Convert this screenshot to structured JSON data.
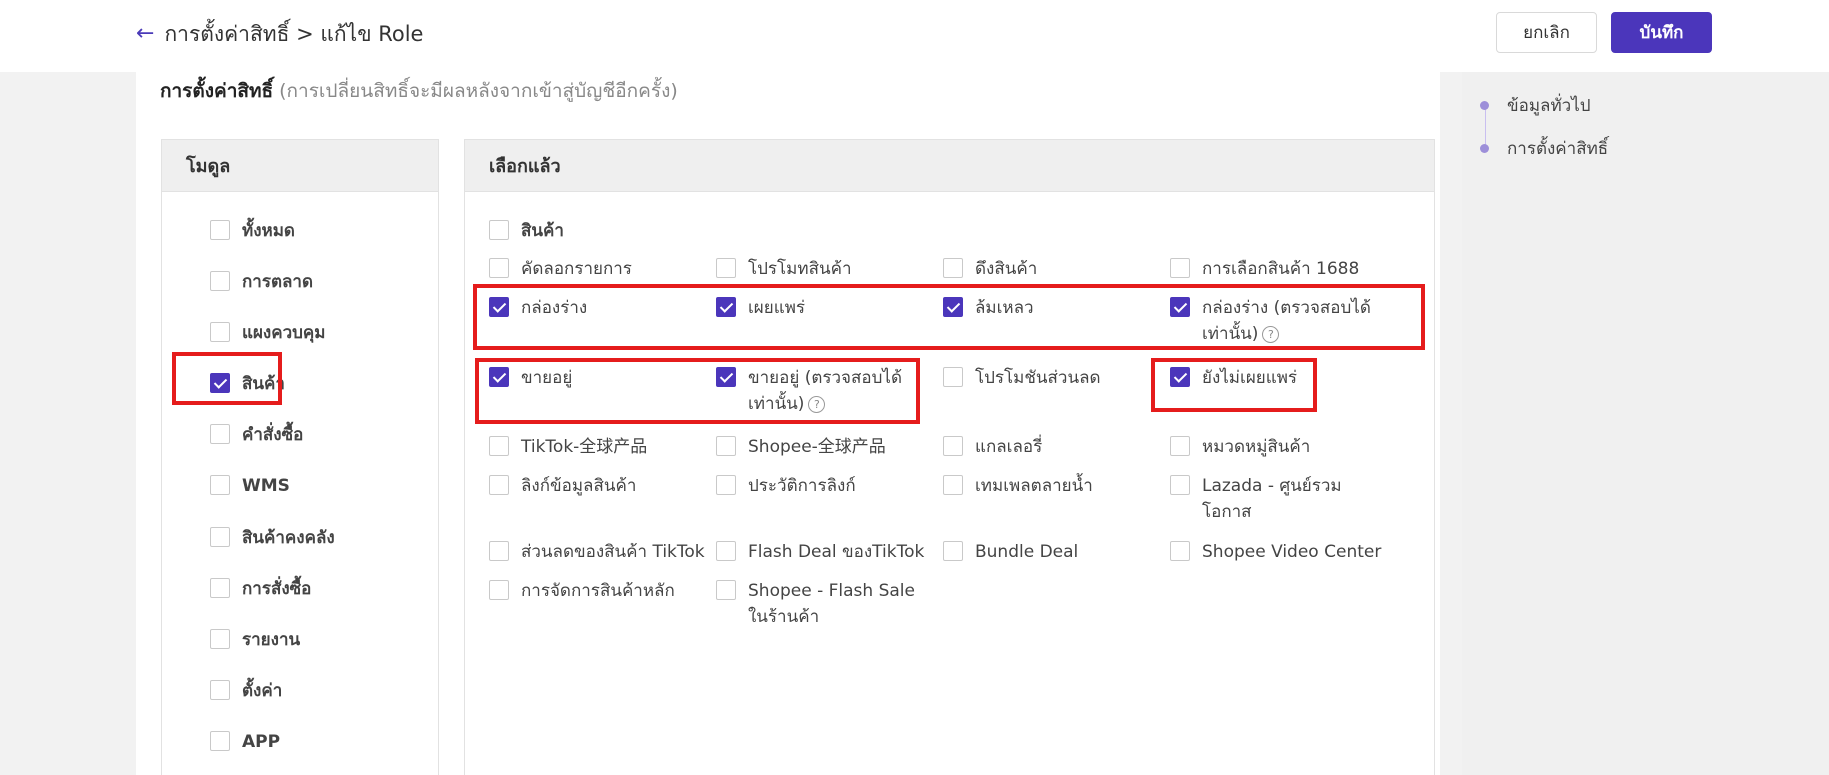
{
  "header": {
    "back_label": "การตั้งค่าสิทธิ์ > แก้ไข Role",
    "cancel_label": "ยกเลิก",
    "save_label": "บันทึก"
  },
  "section": {
    "title": "การตั้งค่าสิทธิ์",
    "note": "(การเปลี่ยนสิทธิ์จะมีผลหลังจากเข้าสู่บัญชีอีกครั้ง)"
  },
  "module_panel": {
    "header": "โมดูล",
    "items": [
      {
        "label": "ทั้งหมด",
        "checked": false
      },
      {
        "label": "การตลาด",
        "checked": false
      },
      {
        "label": "แผงควบคุม",
        "checked": false
      },
      {
        "label": "สินค้า",
        "checked": true
      },
      {
        "label": "คำสั่งซื้อ",
        "checked": false
      },
      {
        "label": "WMS",
        "checked": false
      },
      {
        "label": "สินค้าคงคลัง",
        "checked": false
      },
      {
        "label": "การสั่งซื้อ",
        "checked": false
      },
      {
        "label": "รายงาน",
        "checked": false
      },
      {
        "label": "ตั้งค่า",
        "checked": false
      },
      {
        "label": "APP",
        "checked": false
      }
    ]
  },
  "selected_panel": {
    "header": "เลือกแล้ว",
    "group_label": "สินค้า",
    "group_checked": false,
    "items": [
      {
        "label": "คัดลอกรายการ",
        "checked": false
      },
      {
        "label": "โปรโมทสินค้า",
        "checked": false
      },
      {
        "label": "ดึงสินค้า",
        "checked": false
      },
      {
        "label": "การเลือกสินค้า 1688",
        "checked": false
      },
      {
        "label": "กล่องร่าง",
        "checked": true
      },
      {
        "label": "เผยแพร่",
        "checked": true
      },
      {
        "label": "ล้มเหลว",
        "checked": true
      },
      {
        "label": "กล่องร่าง (ตรวจสอบได้เท่านั้น)",
        "checked": true
      },
      {
        "label": "ขายอยู่",
        "checked": true
      },
      {
        "label": "ขายอยู่ (ตรวจสอบได้เท่านั้น)",
        "checked": true
      },
      {
        "label": "โปรโมชันส่วนลด",
        "checked": false
      },
      {
        "label": "ยังไม่เผยแพร่",
        "checked": true
      },
      {
        "label": "TikTok-全球产品",
        "checked": false
      },
      {
        "label": "Shopee-全球产品",
        "checked": false
      },
      {
        "label": "แกลเลอรี่",
        "checked": false
      },
      {
        "label": "หมวดหมู่สินค้า",
        "checked": false
      },
      {
        "label": "ลิงก์ข้อมูลสินค้า",
        "checked": false
      },
      {
        "label": "ประวัติการลิงก์",
        "checked": false
      },
      {
        "label": "เทมเพลตลายน้ำ",
        "checked": false
      },
      {
        "label": "Lazada - ศูนย์รวมโอกาส",
        "checked": false
      },
      {
        "label": "ส่วนลดของสินค้า TikTok",
        "checked": false
      },
      {
        "label": "Flash Deal ของTikTok",
        "checked": false
      },
      {
        "label": "Bundle Deal",
        "checked": false
      },
      {
        "label": "Shopee Video Center",
        "checked": false
      },
      {
        "label": "การจัดการสินค้าหลัก",
        "checked": false
      },
      {
        "label": "Shopee - Flash Sale ในร้านค้า",
        "checked": false
      }
    ]
  },
  "anchors": [
    {
      "label": "ข้อมูลทั่วไป"
    },
    {
      "label": "การตั้งค่าสิทธิ์"
    }
  ],
  "colors": {
    "accent": "#4b36bb",
    "highlight": "#e51c1c"
  }
}
